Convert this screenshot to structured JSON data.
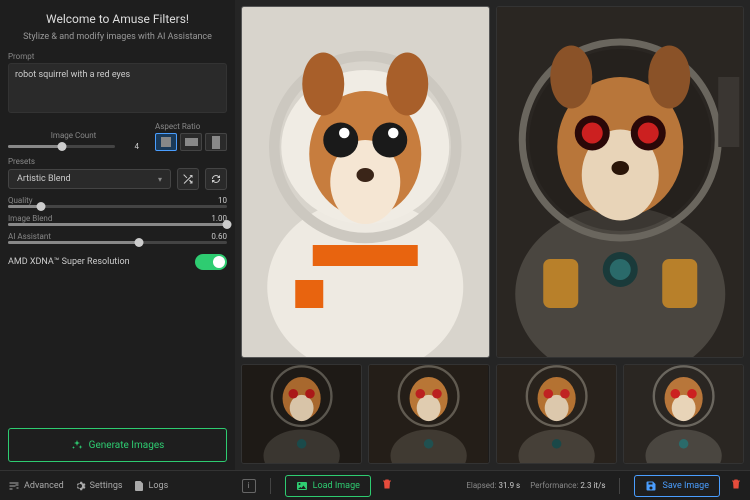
{
  "header": {
    "title": "Welcome to Amuse Filters!",
    "subtitle": "Stylize & and modify images with AI Assistance"
  },
  "prompt": {
    "label": "Prompt",
    "value": "robot squirrel with a red eyes"
  },
  "imageCount": {
    "label": "Image Count",
    "value": "4"
  },
  "aspectRatio": {
    "label": "Aspect Ratio"
  },
  "presets": {
    "label": "Presets",
    "value": "Artistic Blend"
  },
  "quality": {
    "label": "Quality",
    "value": "10"
  },
  "imageBlend": {
    "label": "Image Blend",
    "value": "1.00"
  },
  "aiAssistant": {
    "label": "AI Assistant",
    "value": "0.60"
  },
  "sr": {
    "label": "AMD XDNA™ Super Resolution"
  },
  "generate": {
    "label": "Generate Images"
  },
  "footer": {
    "advanced": "Advanced",
    "settings": "Settings",
    "logs": "Logs",
    "load": "Load Image",
    "save": "Save Image",
    "elapsedLabel": "Elapsed:",
    "elapsedValue": "31.9 s",
    "perfLabel": "Performance:",
    "perfValue": "2.3 it/s"
  }
}
